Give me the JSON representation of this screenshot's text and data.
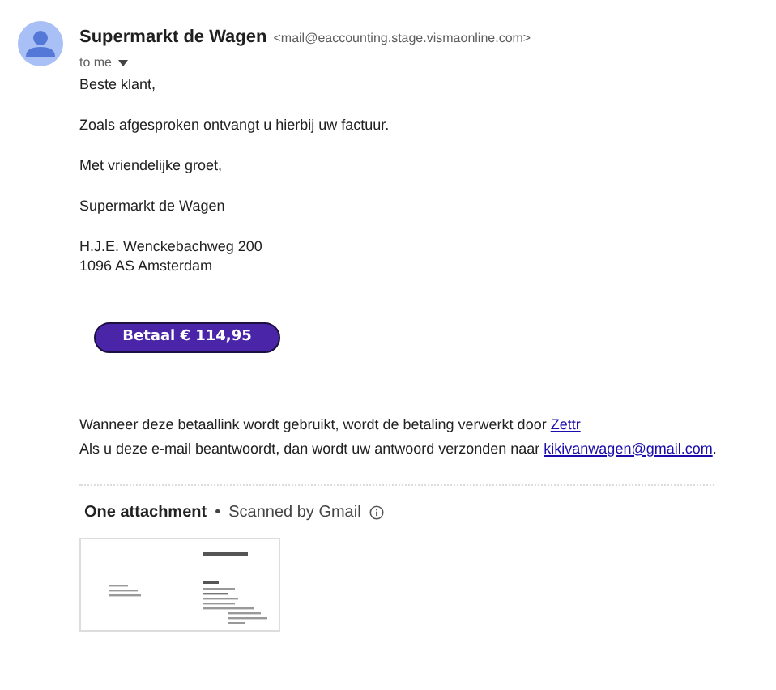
{
  "sender": {
    "name": "Supermarkt de Wagen",
    "address": "<mail@eaccounting.stage.vismaonline.com>"
  },
  "recipient": "to me",
  "body": {
    "greeting": "Beste klant,",
    "message": "Zoals afgesproken ontvangt u hierbij uw factuur.",
    "closing": "Met vriendelijke groet,",
    "signature": "Supermarkt de Wagen",
    "address_lines": [
      "H.J.E. Wenckebachweg 200",
      "1096 AS Amsterdam"
    ]
  },
  "pay_button": "Betaal € 114,95",
  "footer": [
    {
      "text": "Wanneer deze betaallink wordt gebruikt, wordt de betaling verwerkt door ",
      "link": "Zettr"
    },
    {
      "text": "Als u deze e-mail beantwoordt, dan wordt uw antwoord verzonden naar ",
      "link": "kikivanwagen@gmail.com",
      "after": "."
    }
  ],
  "attachments": {
    "title": "One attachment",
    "separator": "•",
    "scan_note": "Scanned by Gmail"
  }
}
